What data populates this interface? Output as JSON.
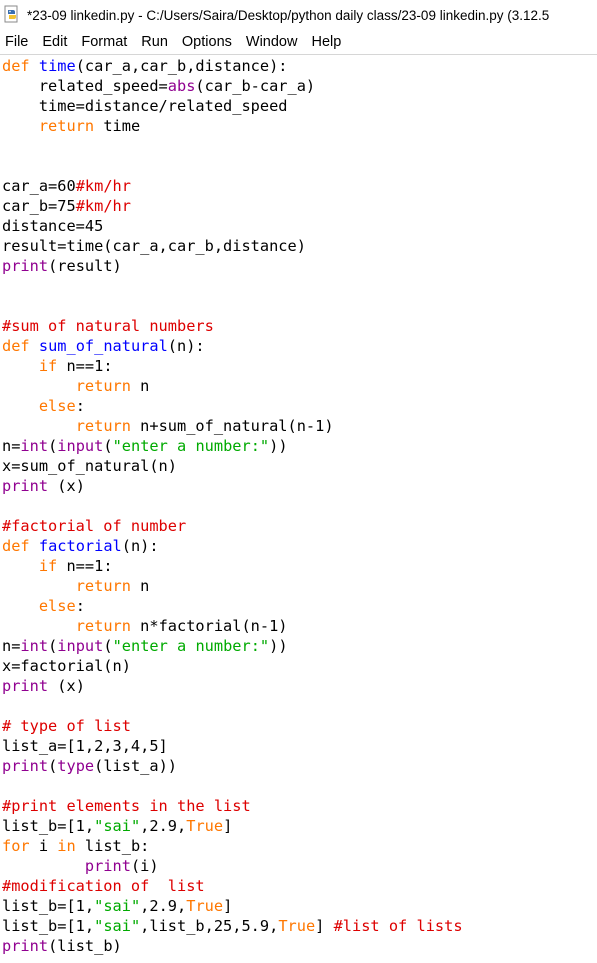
{
  "window": {
    "title": "*23-09 linkedin.py - C:/Users/Saira/Desktop/python daily class/23-09 linkedin.py (3.12.5"
  },
  "menu": [
    "File",
    "Edit",
    "Format",
    "Run",
    "Options",
    "Window",
    "Help"
  ],
  "colors": {
    "keyword": "#ff7700",
    "builtin": "#900090",
    "definition": "#0000ff",
    "string": "#00aa00",
    "comment": "#dd0000",
    "default": "#000000"
  },
  "code": [
    [
      [
        "kw",
        "def"
      ],
      [
        "t",
        " "
      ],
      [
        "fn",
        "time"
      ],
      [
        "t",
        "(car_a,car_b,distance):"
      ]
    ],
    [
      [
        "t",
        "    related_speed="
      ],
      [
        "bi",
        "abs"
      ],
      [
        "t",
        "(car_b-car_a)"
      ]
    ],
    [
      [
        "t",
        "    time=distance/related_speed"
      ]
    ],
    [
      [
        "t",
        "    "
      ],
      [
        "kw",
        "return"
      ],
      [
        "t",
        " time"
      ]
    ],
    [],
    [],
    [
      [
        "t",
        "car_a=60"
      ],
      [
        "cm",
        "#km/hr"
      ]
    ],
    [
      [
        "t",
        "car_b=75"
      ],
      [
        "cm",
        "#km/hr"
      ]
    ],
    [
      [
        "t",
        "distance=45"
      ]
    ],
    [
      [
        "t",
        "result=time(car_a,car_b,distance)"
      ]
    ],
    [
      [
        "bi",
        "print"
      ],
      [
        "t",
        "(result)"
      ]
    ],
    [],
    [],
    [
      [
        "cm",
        "#sum of natural numbers"
      ]
    ],
    [
      [
        "kw",
        "def"
      ],
      [
        "t",
        " "
      ],
      [
        "fn",
        "sum_of_natural"
      ],
      [
        "t",
        "(n):"
      ]
    ],
    [
      [
        "t",
        "    "
      ],
      [
        "kw",
        "if"
      ],
      [
        "t",
        " n==1:"
      ]
    ],
    [
      [
        "t",
        "        "
      ],
      [
        "kw",
        "return"
      ],
      [
        "t",
        " n"
      ]
    ],
    [
      [
        "t",
        "    "
      ],
      [
        "kw",
        "else"
      ],
      [
        "t",
        ":"
      ]
    ],
    [
      [
        "t",
        "        "
      ],
      [
        "kw",
        "return"
      ],
      [
        "t",
        " n+sum_of_natural(n-1)"
      ]
    ],
    [
      [
        "t",
        "n="
      ],
      [
        "bi",
        "int"
      ],
      [
        "t",
        "("
      ],
      [
        "bi",
        "input"
      ],
      [
        "t",
        "("
      ],
      [
        "str",
        "\"enter a number:\""
      ],
      [
        "t",
        "))"
      ]
    ],
    [
      [
        "t",
        "x=sum_of_natural(n)"
      ]
    ],
    [
      [
        "bi",
        "print"
      ],
      [
        "t",
        " (x)"
      ]
    ],
    [],
    [
      [
        "cm",
        "#factorial of number"
      ]
    ],
    [
      [
        "kw",
        "def"
      ],
      [
        "t",
        " "
      ],
      [
        "fn",
        "factorial"
      ],
      [
        "t",
        "(n):"
      ]
    ],
    [
      [
        "t",
        "    "
      ],
      [
        "kw",
        "if"
      ],
      [
        "t",
        " n==1:"
      ]
    ],
    [
      [
        "t",
        "        "
      ],
      [
        "kw",
        "return"
      ],
      [
        "t",
        " n"
      ]
    ],
    [
      [
        "t",
        "    "
      ],
      [
        "kw",
        "else"
      ],
      [
        "t",
        ":"
      ]
    ],
    [
      [
        "t",
        "        "
      ],
      [
        "kw",
        "return"
      ],
      [
        "t",
        " n*factorial(n-1)"
      ]
    ],
    [
      [
        "t",
        "n="
      ],
      [
        "bi",
        "int"
      ],
      [
        "t",
        "("
      ],
      [
        "bi",
        "input"
      ],
      [
        "t",
        "("
      ],
      [
        "str",
        "\"enter a number:\""
      ],
      [
        "t",
        "))"
      ]
    ],
    [
      [
        "t",
        "x=factorial(n)"
      ]
    ],
    [
      [
        "bi",
        "print"
      ],
      [
        "t",
        " (x)"
      ]
    ],
    [],
    [
      [
        "cm",
        "# type of list"
      ]
    ],
    [
      [
        "t",
        "list_a=[1,2,3,4,5]"
      ]
    ],
    [
      [
        "bi",
        "print"
      ],
      [
        "t",
        "("
      ],
      [
        "bi",
        "type"
      ],
      [
        "t",
        "(list_a))"
      ]
    ],
    [],
    [
      [
        "cm",
        "#print elements in the list"
      ]
    ],
    [
      [
        "t",
        "list_b=[1,"
      ],
      [
        "str",
        "\"sai\""
      ],
      [
        "t",
        ",2.9,"
      ],
      [
        "kw",
        "True"
      ],
      [
        "t",
        "]"
      ]
    ],
    [
      [
        "kw",
        "for"
      ],
      [
        "t",
        " i "
      ],
      [
        "kw",
        "in"
      ],
      [
        "t",
        " list_b:"
      ]
    ],
    [
      [
        "t",
        "         "
      ],
      [
        "bi",
        "print"
      ],
      [
        "t",
        "(i)"
      ]
    ],
    [
      [
        "cm",
        "#modification of  list"
      ]
    ],
    [
      [
        "t",
        "list_b=[1,"
      ],
      [
        "str",
        "\"sai\""
      ],
      [
        "t",
        ",2.9,"
      ],
      [
        "kw",
        "True"
      ],
      [
        "t",
        "]"
      ]
    ],
    [
      [
        "t",
        "list_b=[1,"
      ],
      [
        "str",
        "\"sai\""
      ],
      [
        "t",
        ",list_b,25,5.9,"
      ],
      [
        "kw",
        "True"
      ],
      [
        "t",
        "] "
      ],
      [
        "cm",
        "#list of lists"
      ]
    ],
    [
      [
        "bi",
        "print"
      ],
      [
        "t",
        "(list_b)"
      ]
    ]
  ]
}
